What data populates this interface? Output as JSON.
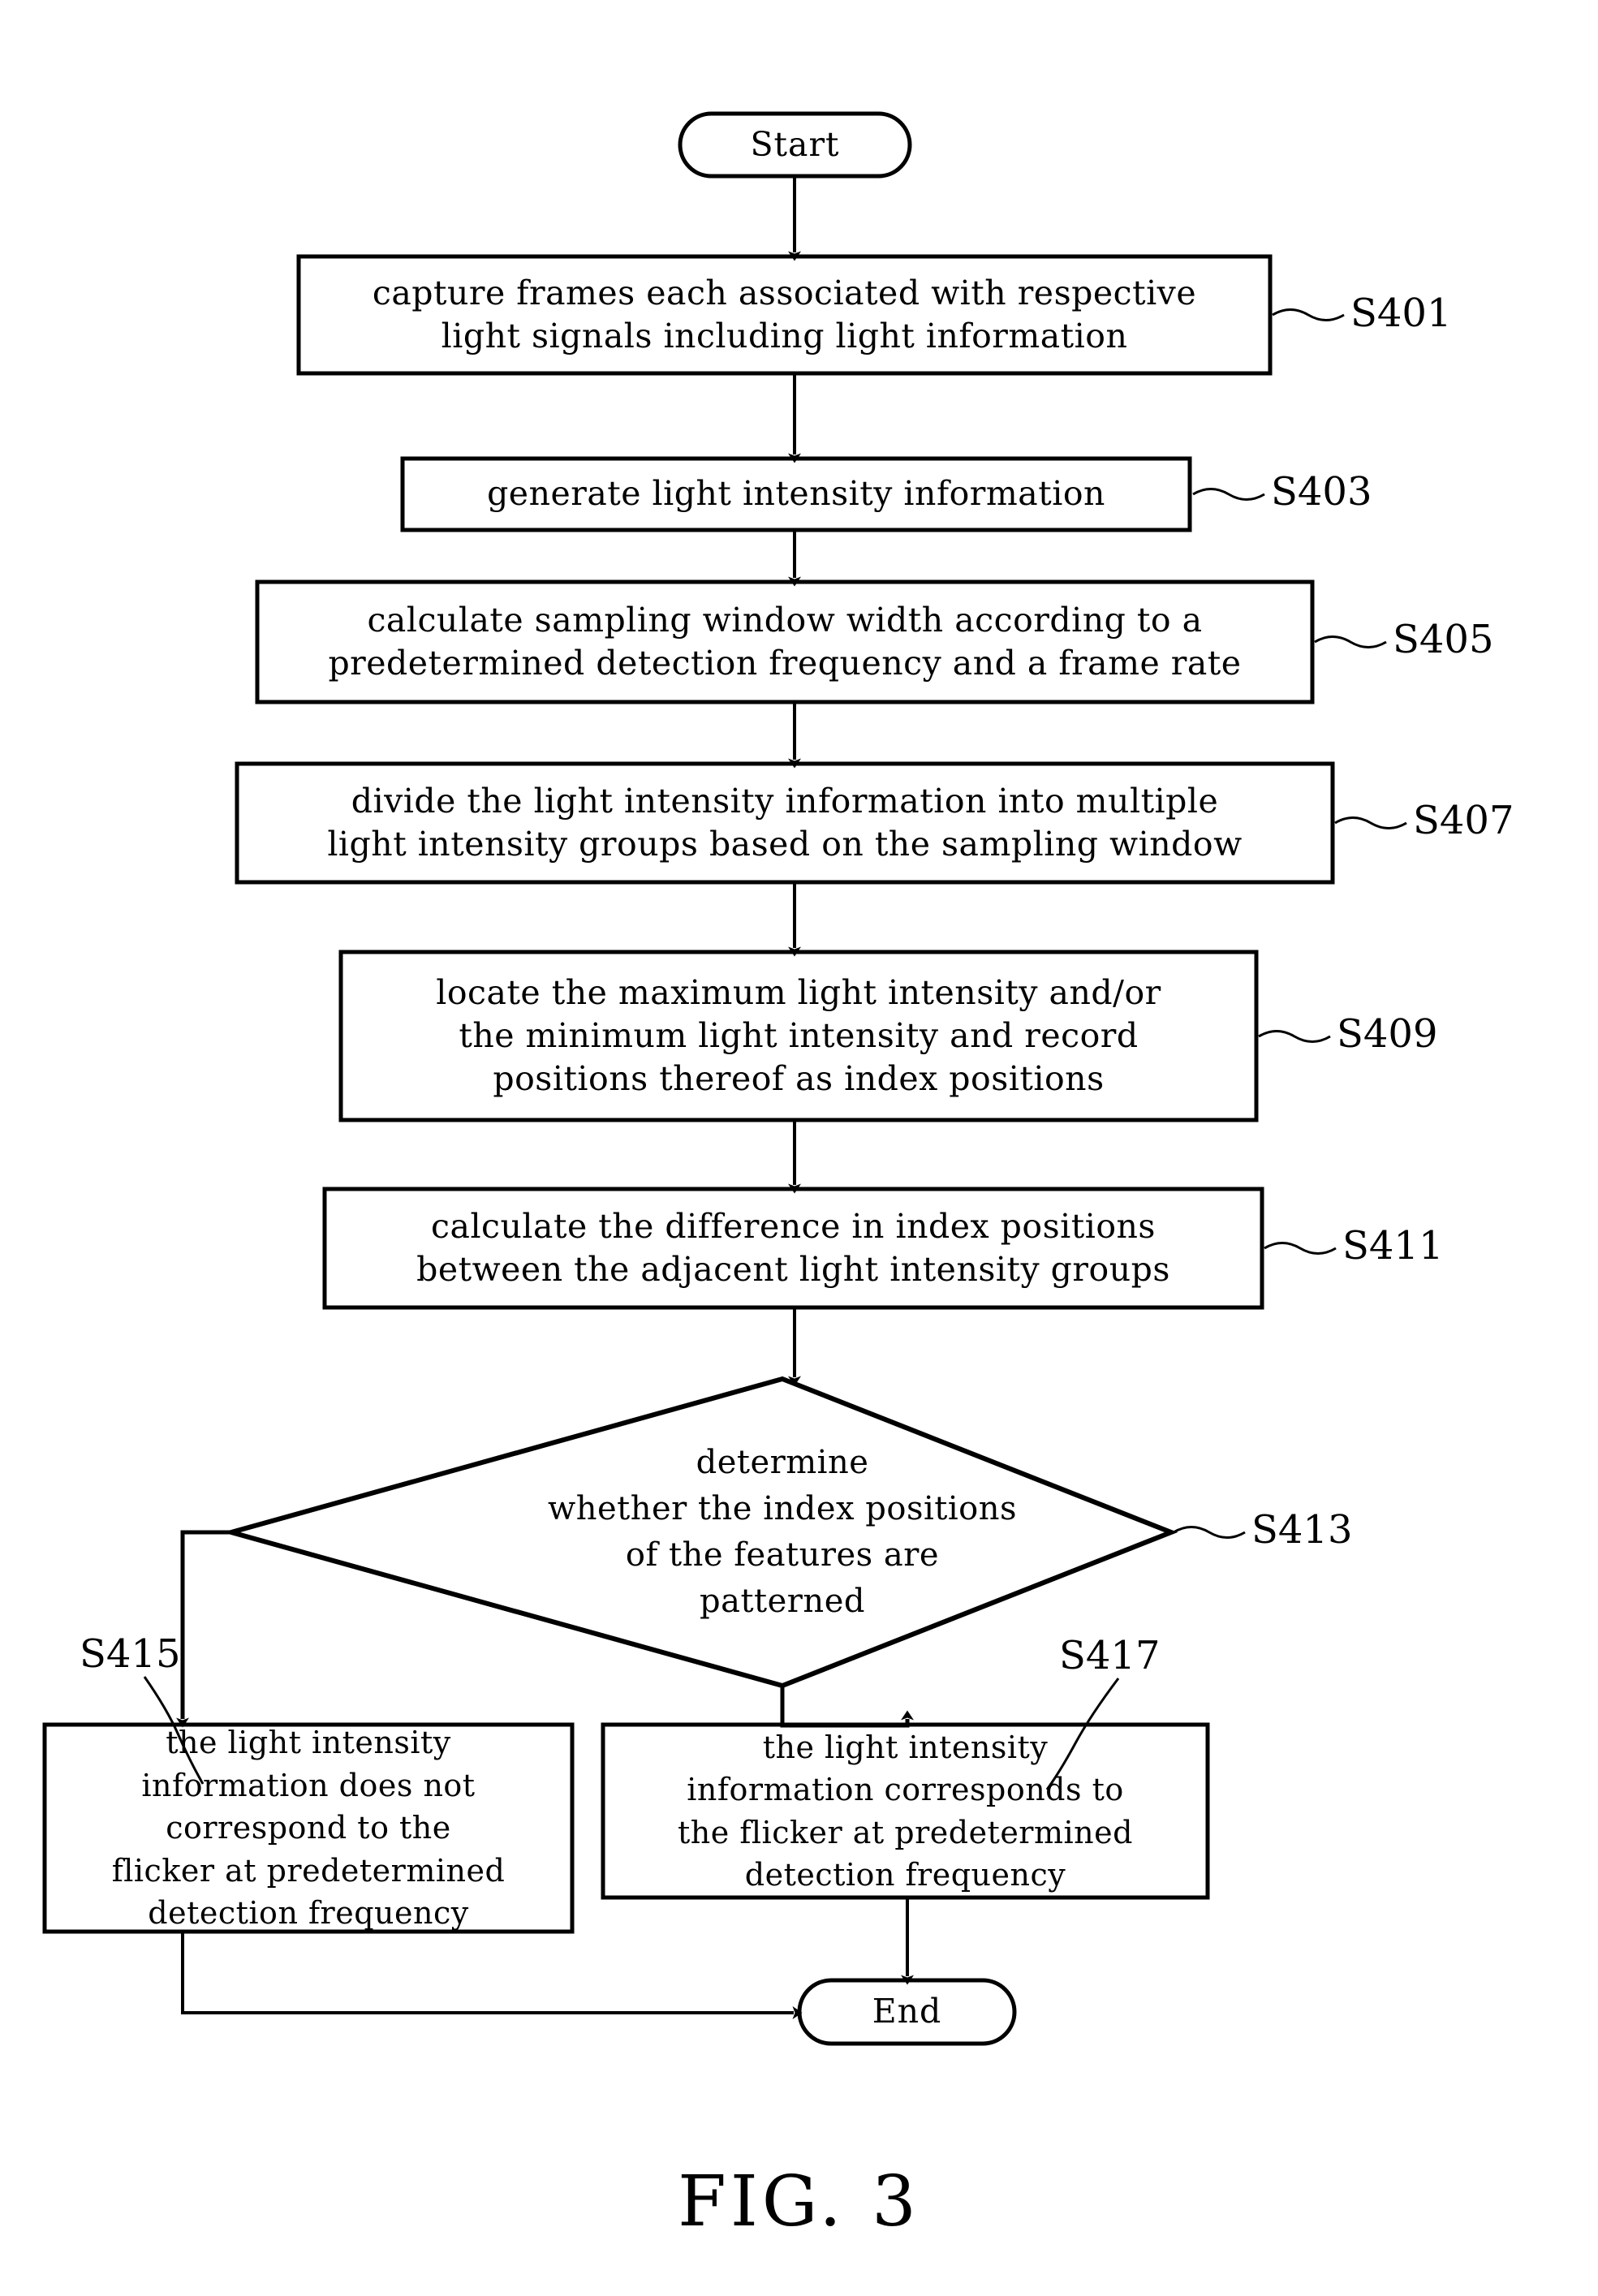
{
  "figure": {
    "caption": "FIG. 3",
    "type": "flowchart"
  },
  "nodes": {
    "start": {
      "kind": "terminal",
      "label": "Start"
    },
    "s401": {
      "kind": "process",
      "ref": "S401",
      "lines": [
        "capture frames each associated with respective",
        "light signals including light information"
      ]
    },
    "s403": {
      "kind": "process",
      "ref": "S403",
      "lines": [
        "generate light intensity information"
      ]
    },
    "s405": {
      "kind": "process",
      "ref": "S405",
      "lines": [
        "calculate sampling window width according to a",
        "predetermined detection frequency and a frame rate"
      ]
    },
    "s407": {
      "kind": "process",
      "ref": "S407",
      "lines": [
        "divide the light intensity information into multiple",
        "light intensity groups based on the sampling window"
      ]
    },
    "s409": {
      "kind": "process",
      "ref": "S409",
      "lines": [
        "locate the maximum light intensity and/or",
        "the minimum light intensity and record",
        "positions thereof as index positions"
      ]
    },
    "s411": {
      "kind": "process",
      "ref": "S411",
      "lines": [
        "calculate the difference in index positions",
        "between the adjacent light intensity groups"
      ]
    },
    "s413": {
      "kind": "decision",
      "ref": "S413",
      "lines": [
        "determine",
        "whether the index positions",
        "of the features are",
        "patterned"
      ]
    },
    "s415": {
      "kind": "process",
      "ref": "S415",
      "lines": [
        "the light intensity",
        "information does not",
        "correspond to the",
        "flicker at predetermined",
        "detection frequency"
      ]
    },
    "s417": {
      "kind": "process",
      "ref": "S417",
      "lines": [
        "the light intensity",
        "information corresponds to",
        "the flicker at predetermined",
        "detection frequency"
      ]
    },
    "end": {
      "kind": "terminal",
      "label": "End"
    }
  },
  "colors": {
    "stroke": "#000000",
    "fill": "#ffffff",
    "text": "#000000"
  }
}
